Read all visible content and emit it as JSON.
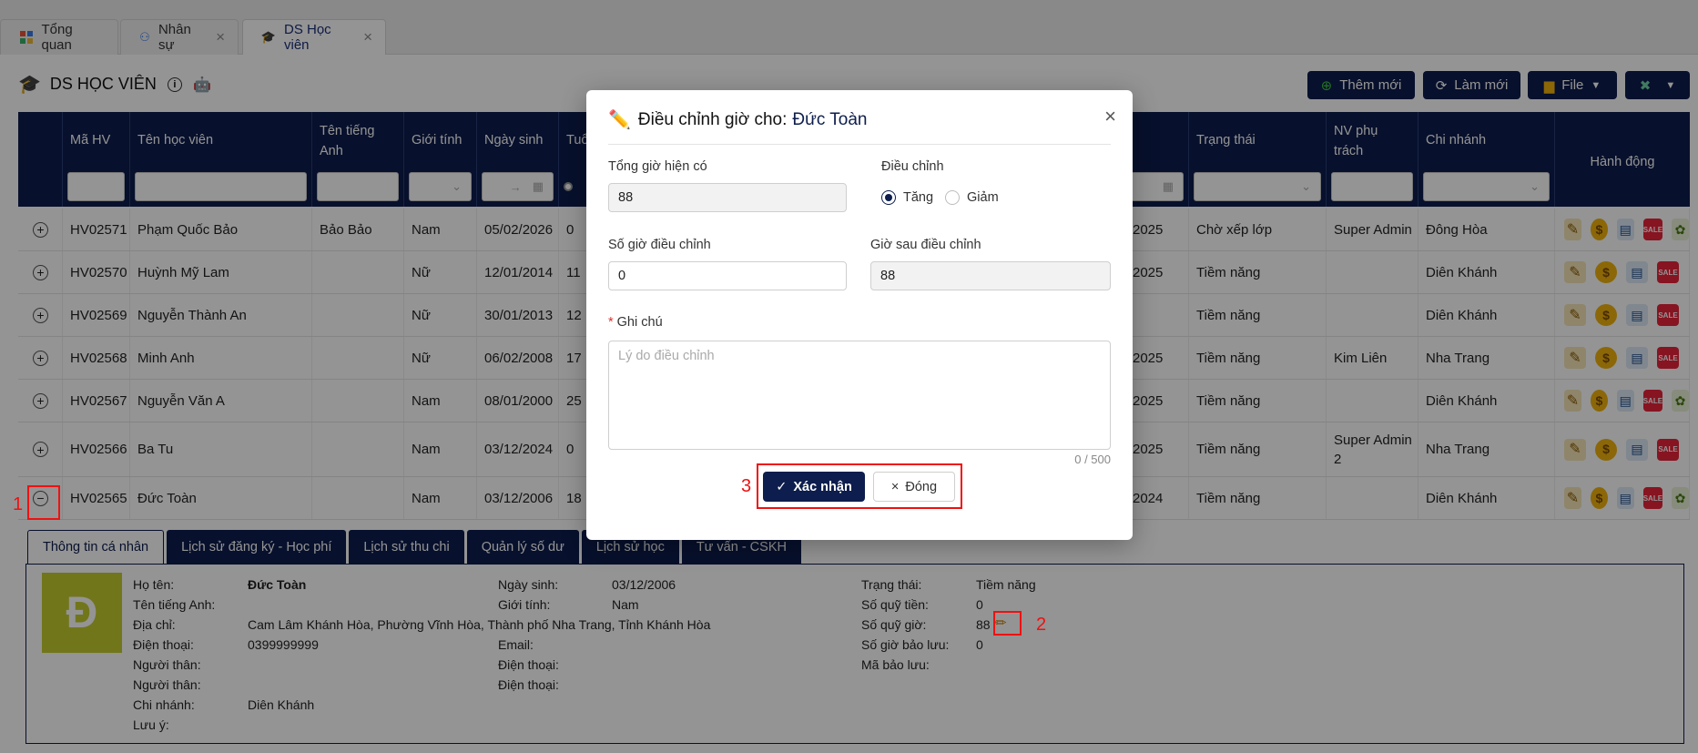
{
  "tabs": [
    {
      "label": "Tổng quan",
      "icon": "dashboard-icon",
      "closable": false,
      "active": false
    },
    {
      "label": "Nhân sự",
      "icon": "org-chart-icon",
      "closable": true,
      "active": false
    },
    {
      "label": "DS Học viên",
      "icon": "graduation-cap-icon",
      "closable": true,
      "active": true
    }
  ],
  "page": {
    "title": "DS HỌC VIÊN"
  },
  "toolbar": {
    "add_label": "Thêm mới",
    "refresh_label": "Làm mới",
    "file_label": "File"
  },
  "table": {
    "columns": {
      "ma_hv": "Mã HV",
      "ten_hoc_vien": "Tên học viên",
      "ten_tieng_anh": "Tên tiếng Anh",
      "gioi_tinh": "Giới tính",
      "ngay_sinh": "Ngày sinh",
      "tuoi": "Tuổ",
      "trang_thai": "Trạng thái",
      "nv_phu_trach": "NV phụ trách",
      "chi_nhanh": "Chi nhánh",
      "hanh_dong": "Hành động"
    },
    "filters": {
      "date_range_arrow": "→"
    },
    "rows": [
      {
        "ma": "HV02571",
        "ten": "Phạm Quốc Bảo",
        "ten_anh": "Bảo Bảo",
        "gioi": "Nam",
        "ngay_sinh": "05/02/2026",
        "tuoi": "0",
        "nam": "2025",
        "trang_thai": "Chờ xếp lớp",
        "nv": "Super Admin",
        "chi_nhanh": "Đông Hòa",
        "expanded": false
      },
      {
        "ma": "HV02570",
        "ten": "Huỳnh Mỹ Lam",
        "ten_anh": "",
        "gioi": "Nữ",
        "ngay_sinh": "12/01/2014",
        "tuoi": "11",
        "nam": "2025",
        "trang_thai": "Tiềm năng",
        "nv": "",
        "chi_nhanh": "Diên Khánh",
        "expanded": false
      },
      {
        "ma": "HV02569",
        "ten": "Nguyễn Thành An",
        "ten_anh": "",
        "gioi": "Nữ",
        "ngay_sinh": "30/01/2013",
        "tuoi": "12",
        "nam": "",
        "trang_thai": "Tiềm năng",
        "nv": "",
        "chi_nhanh": "Diên Khánh",
        "expanded": false
      },
      {
        "ma": "HV02568",
        "ten": "Minh Anh",
        "ten_anh": "",
        "gioi": "Nữ",
        "ngay_sinh": "06/02/2008",
        "tuoi": "17",
        "nam": "2025",
        "trang_thai": "Tiềm năng",
        "nv": "Kim Liên",
        "chi_nhanh": "Nha Trang",
        "expanded": false
      },
      {
        "ma": "HV02567",
        "ten": "Nguyễn Văn A",
        "ten_anh": "",
        "gioi": "Nam",
        "ngay_sinh": "08/01/2000",
        "tuoi": "25",
        "nam": "2025",
        "trang_thai": "Tiềm năng",
        "nv": "",
        "chi_nhanh": "Diên Khánh",
        "expanded": false
      },
      {
        "ma": "HV02566",
        "ten": "Ba Tu",
        "ten_anh": "",
        "gioi": "Nam",
        "ngay_sinh": "03/12/2024",
        "tuoi": "0",
        "nam": "2025",
        "trang_thai": "Tiềm năng",
        "nv": "Super Admin 2",
        "chi_nhanh": "Nha Trang",
        "expanded": false
      },
      {
        "ma": "HV02565",
        "ten": "Đức Toàn",
        "ten_anh": "",
        "gioi": "Nam",
        "ngay_sinh": "03/12/2006",
        "tuoi": "18",
        "nam": "2024",
        "trang_thai": "Tiềm năng",
        "nv": "",
        "chi_nhanh": "Diên Khánh",
        "expanded": true
      }
    ],
    "action_icons": [
      "edit-icon",
      "coin-icon",
      "document-icon",
      "sale-tag-icon",
      "gift-icon"
    ],
    "sale_label": "SALE"
  },
  "detail": {
    "tabs": [
      "Thông tin cá nhân",
      "Lịch sử đăng ký - Học phí",
      "Lịch sử thu chi",
      "Quản lý số dư",
      "Lịch sử học",
      "Tư vấn - CSKH"
    ],
    "avatar_letter": "Đ",
    "col1": {
      "labels": [
        "Họ tên:",
        "Tên tiếng Anh:",
        "Địa chỉ:",
        "Điện thoại:",
        "Người thân:",
        "Người thân:",
        "Chi nhánh:",
        "Lưu ý:"
      ],
      "values": [
        "Đức Toàn",
        "",
        "Cam Lâm Khánh Hòa, Phường Vĩnh Hòa, Thành phố Nha Trang, Tỉnh Khánh Hòa",
        "0399999999",
        "",
        "",
        "Diên Khánh",
        ""
      ]
    },
    "col2": {
      "labels": [
        "Ngày sinh:",
        "Giới tính:",
        "",
        "Email:",
        "Điện thoại:",
        "Điện thoại:"
      ],
      "values": [
        "03/12/2006",
        "Nam",
        "",
        "",
        "",
        ""
      ]
    },
    "col3": {
      "labels": [
        "Trạng thái:",
        "Số quỹ tiền:",
        "Số quỹ giờ:",
        "Số giờ bảo lưu:",
        "Mã bảo lưu:"
      ],
      "values": [
        "Tiềm năng",
        "0",
        "88",
        "0",
        ""
      ]
    }
  },
  "modal": {
    "title_prefix": "Điều chỉnh giờ cho:",
    "student_name": "Đức Toàn",
    "current_hours_label": "Tổng giờ hiện có",
    "current_hours_value": "88",
    "adjust_label": "Điều chỉnh",
    "increase_label": "Tăng",
    "decrease_label": "Giảm",
    "selected_direction": "increase",
    "adjust_hours_label": "Số giờ điều chỉnh",
    "adjust_hours_value": "0",
    "after_hours_label": "Giờ sau điều chỉnh",
    "after_hours_value": "88",
    "note_label": "Ghi chú",
    "note_placeholder": "Lý do điều chỉnh",
    "note_counter": "0 / 500",
    "confirm_label": "Xác nhận",
    "close_label": "Đóng"
  },
  "annotations": {
    "step1": "1",
    "step2": "2",
    "step3": "3"
  },
  "colors": {
    "primary": "#0d1d4d",
    "annotation": "#e11111",
    "avatar": "#c3cb30"
  }
}
